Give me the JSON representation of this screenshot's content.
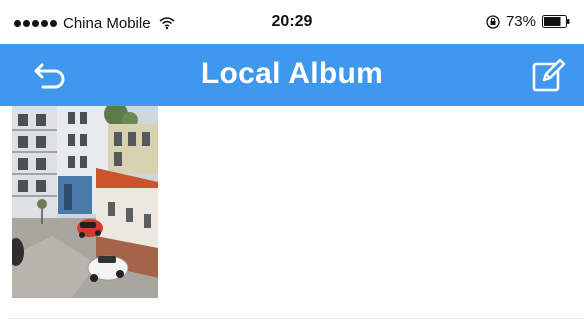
{
  "status_bar": {
    "carrier": "China Mobile",
    "time": "20:29",
    "battery": "73%",
    "icons": [
      "signal-dots-icon",
      "wifi-icon",
      "rotation-lock-icon",
      "battery-icon"
    ]
  },
  "nav": {
    "title": "Local Album",
    "back_icon": "back-arrow-icon",
    "edit_icon": "edit-icon",
    "bar_color": "#3f97ee"
  },
  "album": {
    "items": [
      {
        "type": "photo",
        "icon": "photo-thumbnail"
      }
    ]
  }
}
